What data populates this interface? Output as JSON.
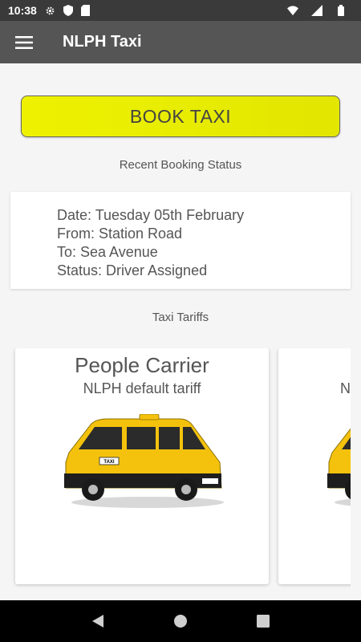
{
  "status_bar": {
    "time": "10:38",
    "icons_left": [
      "settings-icon",
      "shield-icon",
      "sd-card-icon"
    ],
    "icons_right": [
      "wifi-icon",
      "signal-icon",
      "battery-icon"
    ]
  },
  "app_bar": {
    "title": "NLPH Taxi",
    "menu_icon": "hamburger-menu-icon"
  },
  "main": {
    "book_button_label": "BOOK TAXI",
    "recent_booking_label": "Recent Booking Status",
    "recent_booking": {
      "date": "Date: Tuesday 05th February",
      "from": "From: Station Road",
      "to": "To: Sea Avenue",
      "status": "Status: Driver Assigned"
    },
    "tariffs_label": "Taxi Tariffs",
    "tariffs": [
      {
        "name": "People Carrier",
        "description": "NLPH default tariff",
        "image": "yellow-taxi-van",
        "van_sign": "TAXI"
      },
      {
        "name": "",
        "description": "N",
        "image": "yellow-taxi-van"
      }
    ]
  },
  "nav_bar": {
    "icons": [
      "back-icon",
      "home-icon",
      "recents-icon"
    ]
  },
  "colors": {
    "app_bar": "#555555",
    "status_bar": "#3a3a3a",
    "book_button": "#e6eb00",
    "background": "#f5f5f5",
    "text": "#555555"
  }
}
